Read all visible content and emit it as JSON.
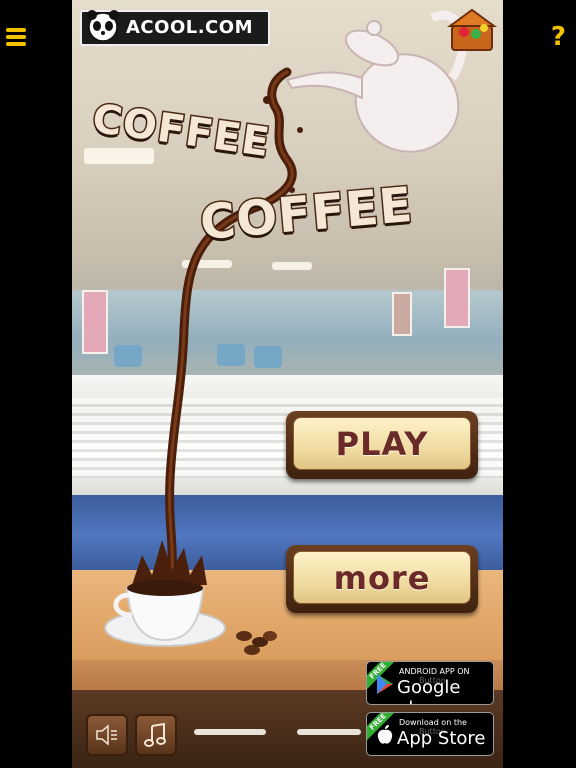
{
  "site": {
    "logo_text": "ACOOL.COM"
  },
  "game": {
    "title_line1": "COFFEE",
    "title_line2": "COFFEE",
    "play_label": "PLAY",
    "more_label": "more"
  },
  "stores": {
    "google": {
      "small": "ANDROID APP ON",
      "big": "Google play",
      "free": "FREE",
      "overlay": "Button"
    },
    "apple": {
      "small": "Download on the",
      "big": "App Store",
      "free": "FREE",
      "overlay": "Button"
    }
  },
  "side": {
    "help": "?"
  },
  "icons": [
    "menu-icon",
    "help-icon",
    "panda-icon",
    "gift-icon",
    "speaker-icon",
    "music-note-icon",
    "android-icon",
    "apple-icon"
  ],
  "colors": {
    "accent": "#f2c200",
    "button_text": "#6b2a2a",
    "frame_brown": "#4a2a14"
  }
}
